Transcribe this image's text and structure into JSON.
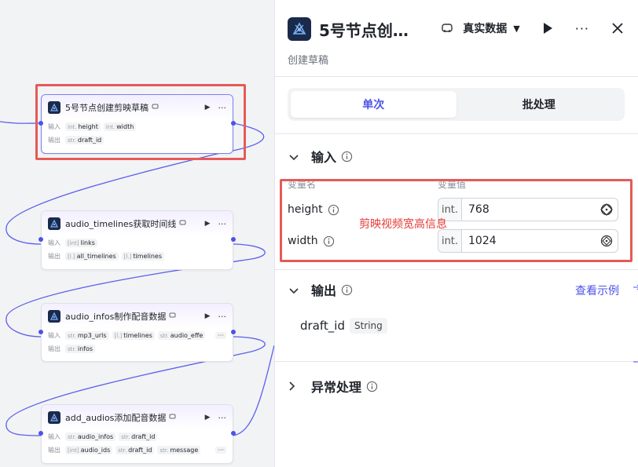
{
  "canvas": {
    "nodes": [
      {
        "title": "5号节点创建剪映草稿",
        "rows": [
          {
            "label": "输入",
            "tags": [
              {
                "type": "int.",
                "name": "height"
              },
              {
                "type": "int.",
                "name": "width"
              }
            ]
          },
          {
            "label": "输出",
            "tags": [
              {
                "type": "str.",
                "name": "draft_id"
              }
            ]
          }
        ]
      },
      {
        "title": "audio_timelines获取时间线",
        "rows": [
          {
            "label": "输入",
            "tags": [
              {
                "type": "[int]",
                "name": "links"
              }
            ]
          },
          {
            "label": "输出",
            "tags": [
              {
                "type": "[l.]",
                "name": "all_timelines"
              },
              {
                "type": "[l.]",
                "name": "timelines"
              }
            ]
          }
        ]
      },
      {
        "title": "audio_infos制作配音数据",
        "rows": [
          {
            "label": "输入",
            "tags": [
              {
                "type": "str.",
                "name": "mp3_urls"
              },
              {
                "type": "[l.]",
                "name": "timelines"
              },
              {
                "type": "str.",
                "name": "audio_effe"
              }
            ],
            "more": "···"
          },
          {
            "label": "输出",
            "tags": [
              {
                "type": "str.",
                "name": "infos"
              }
            ]
          }
        ]
      },
      {
        "title": "add_audios添加配音数据",
        "rows": [
          {
            "label": "输入",
            "tags": [
              {
                "type": "str.",
                "name": "audio_infos"
              },
              {
                "type": "str.",
                "name": "draft_id"
              }
            ]
          },
          {
            "label": "输出",
            "tags": [
              {
                "type": "[int]",
                "name": "audio_ids"
              },
              {
                "type": "str.",
                "name": "draft_id"
              },
              {
                "type": "str.",
                "name": "message"
              }
            ],
            "more": "···"
          }
        ]
      }
    ],
    "run_icon": "▶",
    "more_icon": "···"
  },
  "panel": {
    "title": "5号节点创…",
    "subtitle": "创建草稿",
    "mode_label": "真实数据",
    "tabs": [
      "单次",
      "批处理"
    ],
    "active_tab": 0,
    "input_section": {
      "title": "输入",
      "col_name": "变量名",
      "col_value": "变量值",
      "vars": [
        {
          "name": "height",
          "type": "int.",
          "value": "768"
        },
        {
          "name": "width",
          "type": "int.",
          "value": "1024"
        }
      ]
    },
    "annotation": "剪映视频宽高信息",
    "output_section": {
      "title": "输出",
      "link": "查看示例",
      "vars": [
        {
          "name": "draft_id",
          "type": "String"
        }
      ]
    },
    "error_section": {
      "title": "异常处理"
    }
  },
  "colors": {
    "accent": "#4d53e8",
    "highlight": "#e55a57",
    "wire": "#4d53e8"
  }
}
